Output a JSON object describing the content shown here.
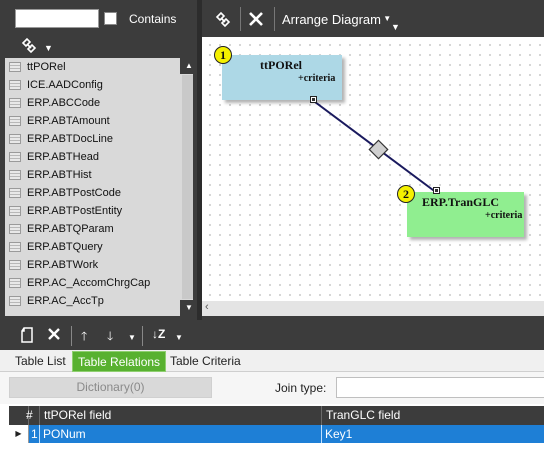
{
  "left_panel": {
    "search_value": "",
    "contains_label": "Contains",
    "tables": [
      "ttPORel",
      "ICE.AADConfig",
      "ERP.ABCCode",
      "ERP.ABTAmount",
      "ERP.ABTDocLine",
      "ERP.ABTHead",
      "ERP.ABTHist",
      "ERP.ABTPostCode",
      "ERP.ABTPostEntity",
      "ERP.ABTQParam",
      "ERP.ABTQuery",
      "ERP.ABTWork",
      "ERP.AC_AccomChrgCap",
      "ERP.AC_AccTp"
    ]
  },
  "diagram": {
    "arrange_label": "Arrange Diagram",
    "entities": [
      {
        "badge": "1",
        "name": "ttPORel",
        "criteria": "+criteria",
        "color": "#add8e6"
      },
      {
        "badge": "2",
        "name": "ERP.TranGLC",
        "criteria": "+criteria",
        "color": "#90ee90"
      }
    ],
    "link_color": "#1a1a5e"
  },
  "tabs": [
    "Table List",
    "Table Relations",
    "Table Criteria"
  ],
  "active_tab": "Table Relations",
  "relations": {
    "dictionary_label": "Dictionary(0)",
    "join_type_label": "Join type:",
    "join_type_value": ""
  },
  "grid": {
    "columns": [
      "#",
      "ttPORel field",
      "TranGLC field"
    ],
    "rows": [
      {
        "index": "1",
        "left_field": "PONum",
        "right_field": "Key1"
      }
    ]
  },
  "colors": {
    "accent_tab": "#58b130",
    "selected_row": "#1e7fd6",
    "toolbar_dark": "#3c3c3c"
  }
}
